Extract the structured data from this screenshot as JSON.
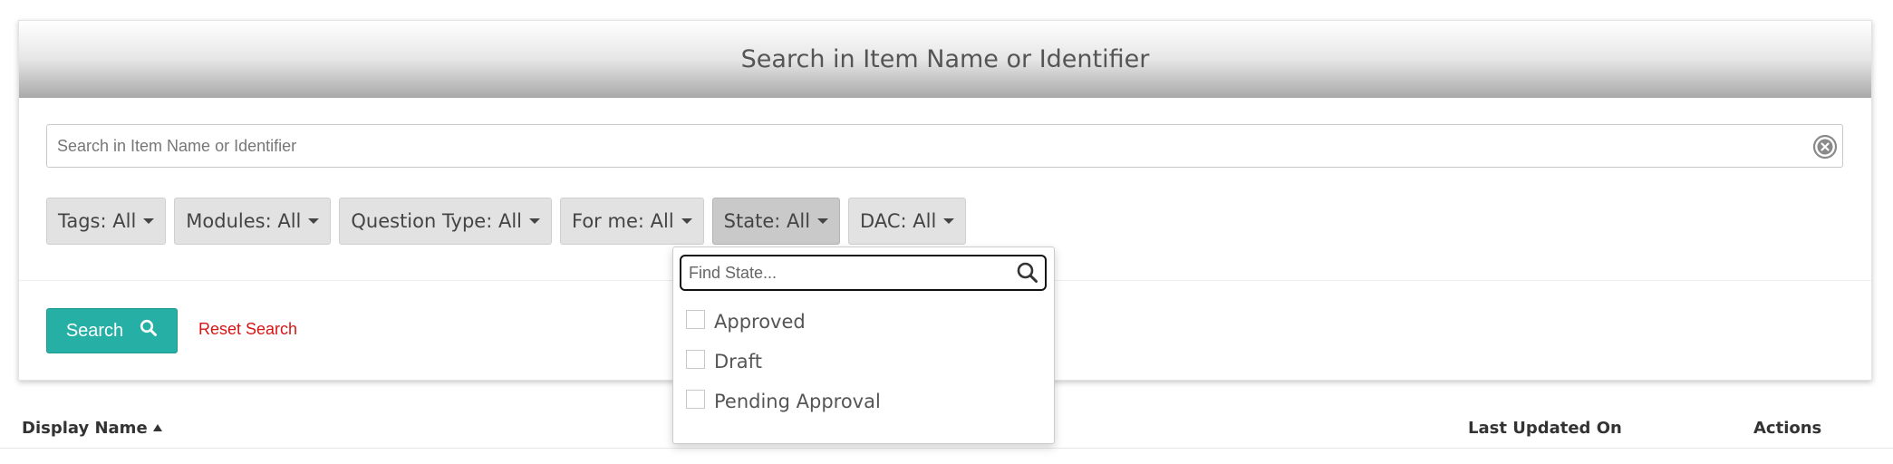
{
  "header": {
    "title": "Search in Item Name or Identifier"
  },
  "search": {
    "placeholder": "Search in Item Name or Identifier",
    "value": ""
  },
  "filters": [
    {
      "label": "Tags: All"
    },
    {
      "label": "Modules: All"
    },
    {
      "label": "Question Type: All"
    },
    {
      "label": "For me: All"
    },
    {
      "label": "State: All",
      "active": true
    },
    {
      "label": "DAC: All"
    }
  ],
  "actions": {
    "search_label": "Search",
    "reset_label": "Reset Search"
  },
  "state_dropdown": {
    "find_placeholder": "Find State...",
    "options": [
      {
        "label": "Approved",
        "checked": false
      },
      {
        "label": "Draft",
        "checked": false
      },
      {
        "label": "Pending Approval",
        "checked": false
      }
    ]
  },
  "table": {
    "columns": [
      {
        "label": "Display Name",
        "sort": "ascending"
      },
      {
        "label": "Last Updated On"
      },
      {
        "label": "Actions"
      }
    ]
  },
  "colors": {
    "accent": "#26b0a5",
    "reset_link": "#d61515",
    "filter_bg": "#e2e2e2",
    "filter_active_bg": "#c9c9c9"
  },
  "icons": {
    "clear": "circle-x-icon",
    "search": "magnifier-icon",
    "caret": "caret-down-icon",
    "sort": "sort-up-icon"
  }
}
